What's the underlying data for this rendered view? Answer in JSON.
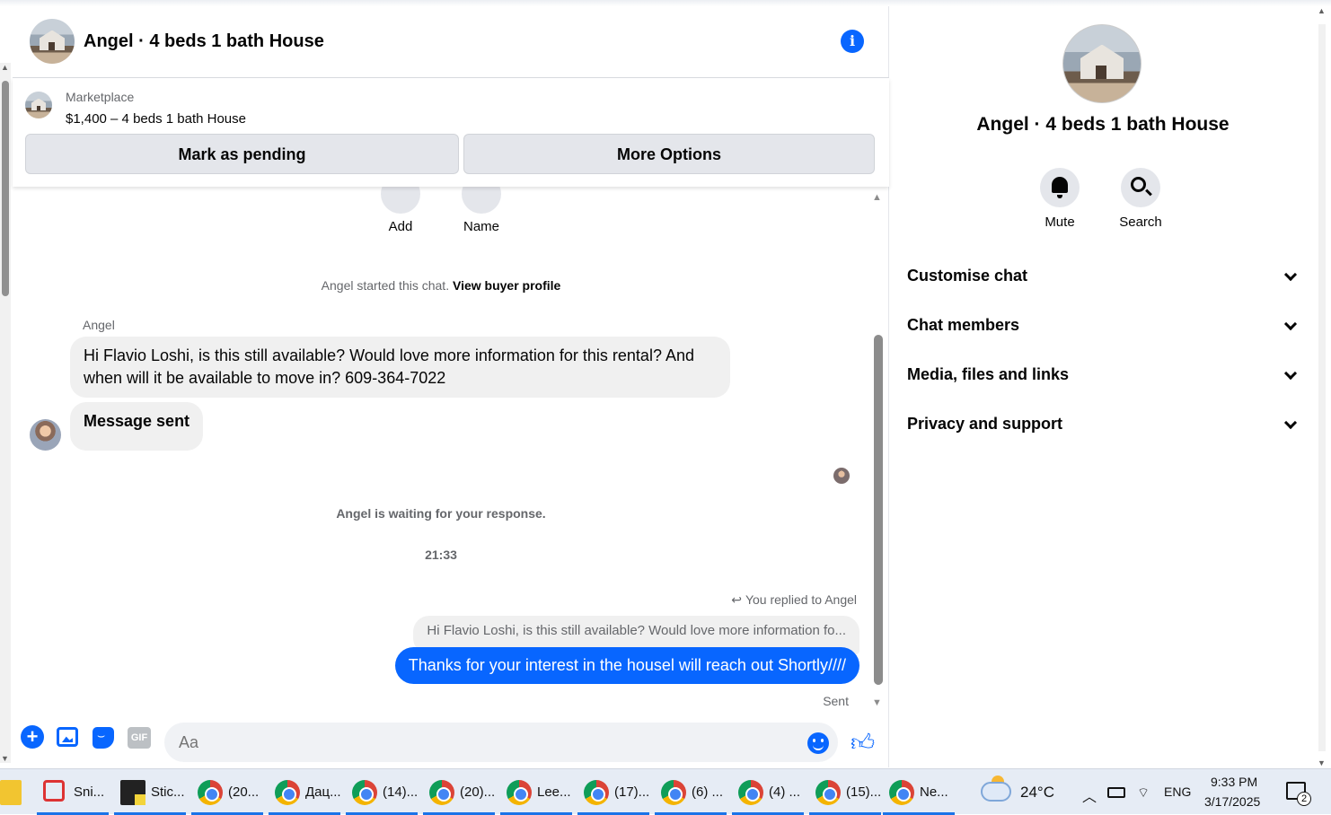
{
  "header": {
    "title": "Angel · 4 beds 1 bath House"
  },
  "marketplace": {
    "label": "Marketplace",
    "listing": "$1,400 – 4 beds 1 bath House",
    "pending_button": "Mark as pending",
    "more_button": "More Options"
  },
  "actions": {
    "add": "Add",
    "name": "Name"
  },
  "messages": {
    "started_prefix": "Angel started this chat.",
    "view_profile": "View buyer profile",
    "sender": "Angel",
    "msg1": "Hi Flavio Loshi, is this still available? Would love more information for this rental? And when will it be available to move in? 609-364-7022",
    "msg2": "Message sent",
    "waiting": "Angel is waiting for your response.",
    "time": "21:33",
    "replied": "You replied to Angel",
    "quoted": "Hi Flavio Loshi, is this still available? Would love more information fo...",
    "outgoing": "Thanks for your interest in the housel will reach out Shortly////",
    "sent": "Sent"
  },
  "composer": {
    "placeholder": "Aa",
    "gif_label": "GIF"
  },
  "info_panel": {
    "title": "Angel · 4 beds 1 bath House",
    "mute": "Mute",
    "search": "Search",
    "sections": [
      "Customise chat",
      "Chat members",
      "Media, files and links",
      "Privacy and support"
    ]
  },
  "taskbar": {
    "apps": [
      {
        "label": "Sni...",
        "icon": "snipping-tool-icon"
      },
      {
        "label": "Stic...",
        "icon": "sticky-notes-icon"
      },
      {
        "label": "(20...",
        "icon": "chrome-icon"
      },
      {
        "label": "Дац...",
        "icon": "chrome-icon"
      },
      {
        "label": "(14)...",
        "icon": "chrome-icon"
      },
      {
        "label": "(20)...",
        "icon": "chrome-icon"
      },
      {
        "label": "Lee...",
        "icon": "chrome-icon"
      },
      {
        "label": "(17)...",
        "icon": "chrome-icon"
      },
      {
        "label": "(6) ...",
        "icon": "chrome-icon"
      },
      {
        "label": "(4) ...",
        "icon": "chrome-icon"
      },
      {
        "label": "(15)...",
        "icon": "chrome-icon"
      },
      {
        "label": "Ne...",
        "icon": "chrome-icon"
      }
    ],
    "temperature": "24°C",
    "language": "ENG",
    "time": "9:33 PM",
    "date": "3/17/2025",
    "notifications": "2"
  },
  "colors": {
    "accent": "#0866ff",
    "bubble_in": "#f0f0f0",
    "taskbar": "#e6ecf5"
  }
}
